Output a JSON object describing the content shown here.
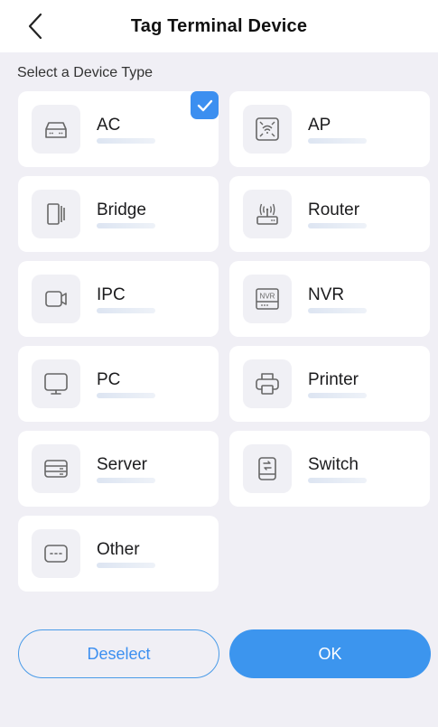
{
  "header": {
    "title": "Tag Terminal Device"
  },
  "section_label": "Select a Device Type",
  "devices": [
    {
      "label": "AC",
      "icon": "ac-icon",
      "selected": true
    },
    {
      "label": "AP",
      "icon": "ap-icon",
      "selected": false
    },
    {
      "label": "Bridge",
      "icon": "bridge-icon",
      "selected": false
    },
    {
      "label": "Router",
      "icon": "router-icon",
      "selected": false
    },
    {
      "label": "IPC",
      "icon": "ipc-camera-icon",
      "selected": false
    },
    {
      "label": "NVR",
      "icon": "nvr-icon",
      "selected": false
    },
    {
      "label": "PC",
      "icon": "pc-monitor-icon",
      "selected": false
    },
    {
      "label": "Printer",
      "icon": "printer-icon",
      "selected": false
    },
    {
      "label": "Server",
      "icon": "server-icon",
      "selected": false
    },
    {
      "label": "Switch",
      "icon": "switch-icon",
      "selected": false
    },
    {
      "label": "Other",
      "icon": "other-icon",
      "selected": false
    }
  ],
  "icon_text": {
    "nvr": "NVR"
  },
  "buttons": {
    "deselect": "Deselect",
    "ok": "OK"
  },
  "colors": {
    "accent": "#3c95ee",
    "background": "#f0eff5",
    "card": "#ffffff",
    "icon_bg": "#f0f0f5"
  }
}
